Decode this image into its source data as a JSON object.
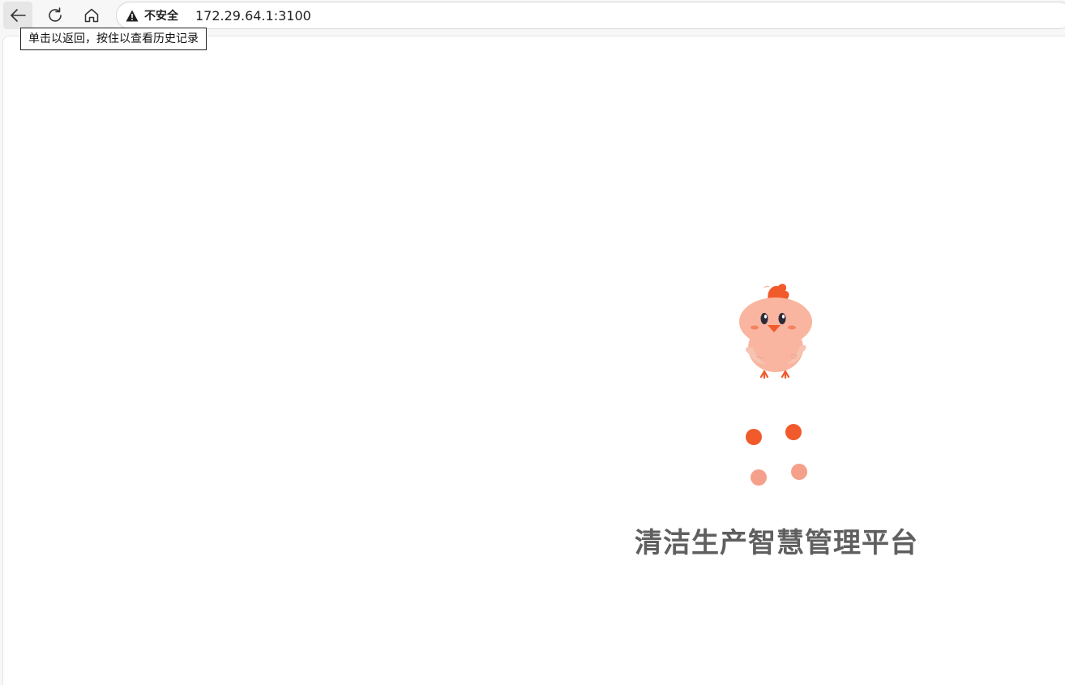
{
  "browser": {
    "back_tooltip": "单击以返回，按住以查看历史记录",
    "security_label": "不安全",
    "url": "172.29.64.1:3100",
    "icons": [
      "back-arrow-icon",
      "reload-icon",
      "home-icon",
      "warning-icon"
    ]
  },
  "page": {
    "title": "清洁生产智慧管理平台",
    "loader": {
      "mascot": "chick-icon",
      "dot_colors": [
        "#f15a2b",
        "#f15a2b",
        "#f5a08a",
        "#f5a08a"
      ]
    }
  },
  "colors": {
    "accent": "#f15a2b",
    "accent_light": "#f5a08a",
    "chick_body": "#f9b59f",
    "title_text": "#5f5f5f"
  }
}
